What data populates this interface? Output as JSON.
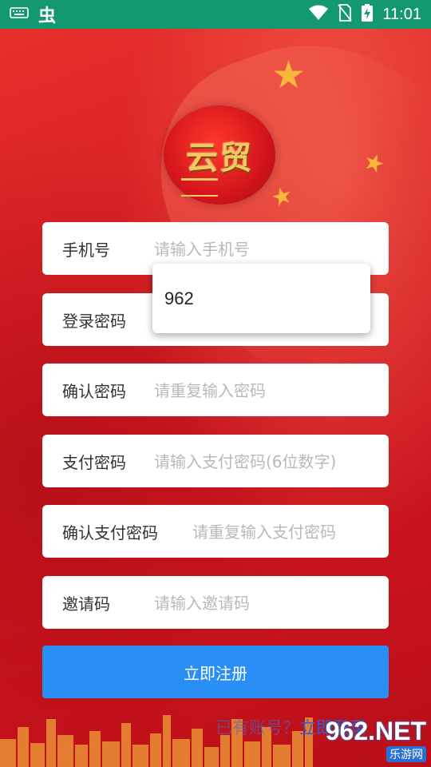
{
  "status_bar": {
    "time": "11:01",
    "app_glyph": "虫"
  },
  "logo": {
    "text": "云贸"
  },
  "form": {
    "fields": [
      {
        "label": "手机号",
        "placeholder": "请输入手机号",
        "value": ""
      },
      {
        "label": "登录密码",
        "placeholder": "",
        "value": ""
      },
      {
        "label": "确认密码",
        "placeholder": "请重复输入密码",
        "value": ""
      },
      {
        "label": "支付密码",
        "placeholder": "请输入支付密码(6位数字)",
        "value": ""
      },
      {
        "label": "确认支付密码",
        "placeholder": "请重复输入支付密码",
        "value": ""
      },
      {
        "label": "邀请码",
        "placeholder": "请输入邀请码",
        "value": ""
      }
    ],
    "autocomplete_suggestion": "962",
    "submit_label": "立即注册"
  },
  "login_link": {
    "question": "已有账号？",
    "action": "立即登录"
  },
  "watermark": {
    "main": "962.NET",
    "sub": "乐游网"
  },
  "colors": {
    "status_bar": "#149872",
    "background": "#d81c22",
    "submit_button": "#2a8ff4",
    "link": "#2e5fd6"
  }
}
